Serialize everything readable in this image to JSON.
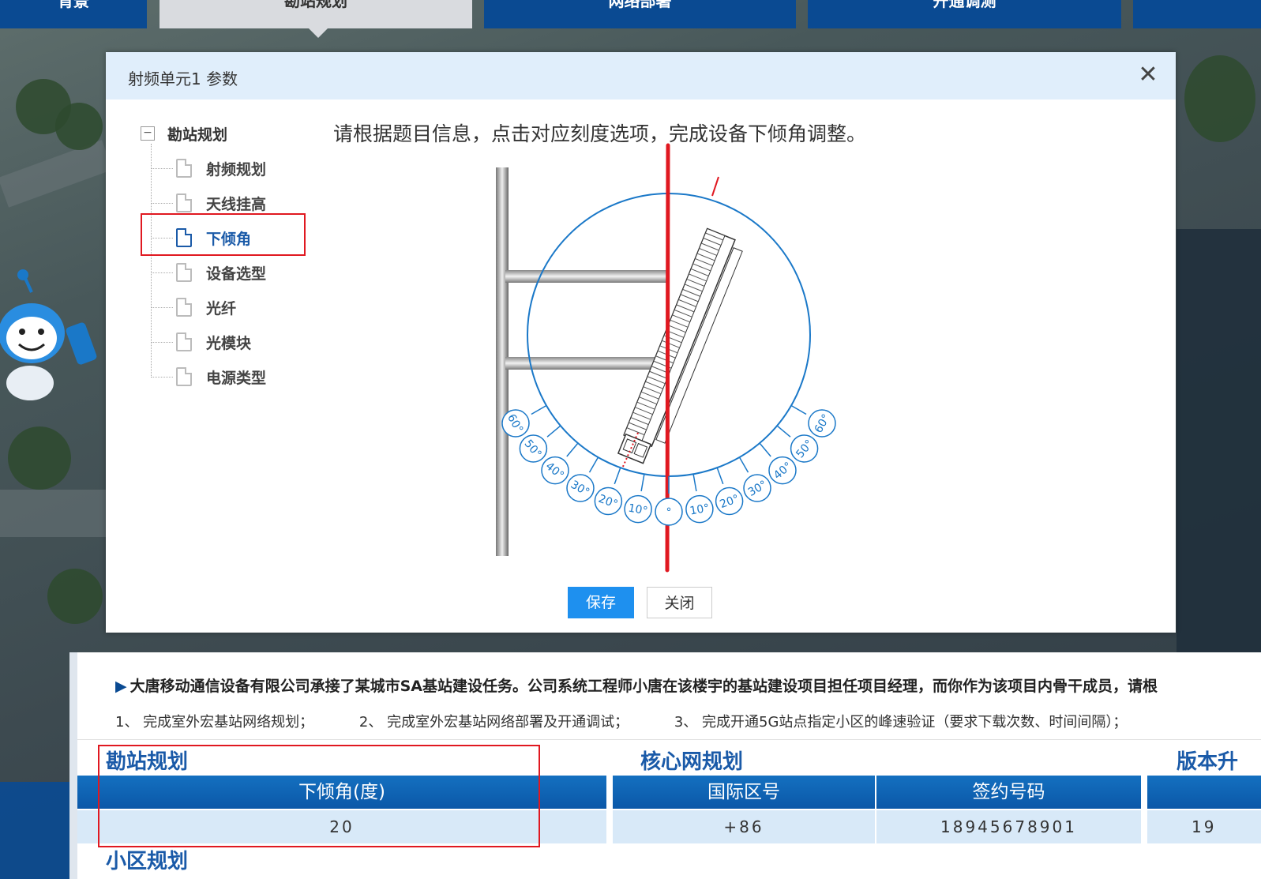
{
  "nav": {
    "tabs": [
      {
        "label": "背景",
        "active": false
      },
      {
        "label": "勘站规划",
        "active": true
      },
      {
        "label": "网络部署",
        "active": false
      },
      {
        "label": "开通调测",
        "active": false
      },
      {
        "label": "",
        "active": false
      }
    ]
  },
  "dialog": {
    "title": "射频单元1 参数",
    "close_icon": "close-icon",
    "tree": {
      "root_label": "勘站规划",
      "root_toggle": "−",
      "items": [
        {
          "label": "射频规划",
          "selected": false
        },
        {
          "label": "天线挂高",
          "selected": false
        },
        {
          "label": "下倾角",
          "selected": true
        },
        {
          "label": "设备选型",
          "selected": false
        },
        {
          "label": "光纤",
          "selected": false
        },
        {
          "label": "光模块",
          "selected": false
        },
        {
          "label": "电源类型",
          "selected": false
        }
      ]
    },
    "instruction": "请根据题目信息，点击对应刻度选项，完成设备下倾角调整。",
    "scale_left": [
      "60°",
      "50°",
      "40°",
      "30°",
      "20°",
      "10°",
      "°"
    ],
    "scale_right": [
      "10°",
      "20°",
      "30°",
      "40°",
      "50°",
      "60°"
    ],
    "save_label": "保存",
    "close_label": "关闭"
  },
  "task": {
    "intro": "大唐移动通信设备有限公司承接了某城市SA基站建设任务。公司系统工程师小唐在该楼宇的基站建设项目担任项目经理，而你作为该项目内骨干成员，请根",
    "items": [
      "1、 完成室外宏基站网络规划；",
      "2、 完成室外宏基站网络部署及开通调试；",
      "3、 完成开通5G站点指定小区的峰速验证（要求下载次数、时间间隔）；"
    ]
  },
  "tables": {
    "survey": {
      "title": "勘站规划",
      "header": "下倾角(度)",
      "value": "20"
    },
    "core": {
      "title": "核心网规划",
      "headers": [
        "国际区号",
        "签约号码"
      ],
      "values": [
        "+86",
        "18945678901"
      ]
    },
    "version": {
      "title": "版本升",
      "value": "19"
    },
    "cell": {
      "title": "小区规划"
    }
  },
  "colors": {
    "brand": "#0a4a92",
    "accent": "#1e90ef",
    "annotation": "#e01820",
    "circle": "#1a78c8"
  }
}
